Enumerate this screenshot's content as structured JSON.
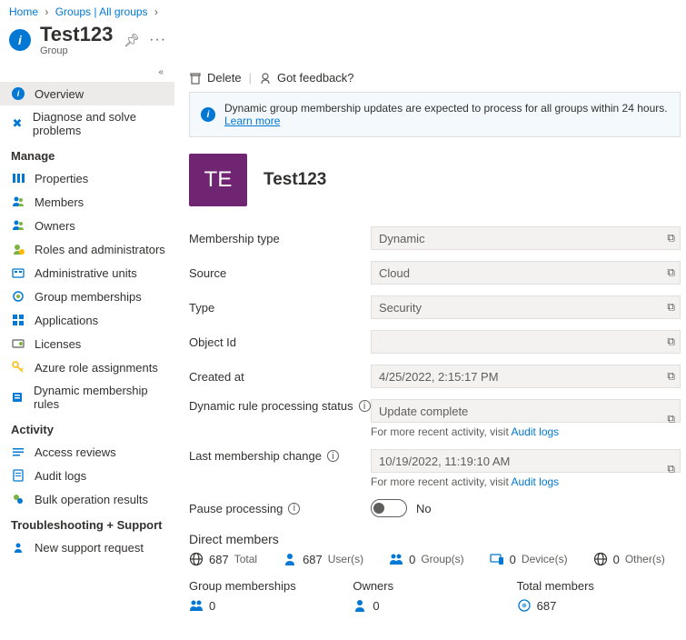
{
  "breadcrumb": {
    "home": "Home",
    "groups": "Groups | All groups"
  },
  "header": {
    "title": "Test123",
    "subtitle": "Group"
  },
  "sidebar": {
    "overview": "Overview",
    "diagnose": "Diagnose and solve problems",
    "heading_manage": "Manage",
    "properties": "Properties",
    "members": "Members",
    "owners": "Owners",
    "roles": "Roles and administrators",
    "admin_units": "Administrative units",
    "group_memberships": "Group memberships",
    "applications": "Applications",
    "licenses": "Licenses",
    "azure_roles": "Azure role assignments",
    "dyn_rules": "Dynamic membership rules",
    "heading_activity": "Activity",
    "access_reviews": "Access reviews",
    "audit_logs": "Audit logs",
    "bulk_results": "Bulk operation results",
    "heading_ts": "Troubleshooting + Support",
    "support_req": "New support request"
  },
  "toolbar": {
    "delete": "Delete",
    "feedback": "Got feedback?"
  },
  "banner": {
    "text": "Dynamic group membership updates are expected to process for all groups within 24 hours.",
    "link": "Learn more"
  },
  "tile": {
    "initials": "TE",
    "title": "Test123"
  },
  "props": {
    "membership_type_label": "Membership type",
    "membership_type_value": "Dynamic",
    "source_label": "Source",
    "source_value": "Cloud",
    "type_label": "Type",
    "type_value": "Security",
    "object_id_label": "Object Id",
    "object_id_value": "",
    "created_label": "Created at",
    "created_value": "4/25/2022, 2:15:17 PM",
    "dyn_status_label": "Dynamic rule processing status",
    "dyn_status_value": "Update complete",
    "hint_prefix": "For more recent activity, visit ",
    "hint_link": "Audit logs",
    "last_change_label": "Last membership change",
    "last_change_value": "10/19/2022, 11:19:10 AM",
    "pause_label": "Pause processing",
    "pause_value": "No"
  },
  "members": {
    "section_title": "Direct members",
    "total_n": "687",
    "total_lbl": "Total",
    "users_n": "687",
    "users_lbl": "User(s)",
    "groups_n": "0",
    "groups_lbl": "Group(s)",
    "devices_n": "0",
    "devices_lbl": "Device(s)",
    "others_n": "0",
    "others_lbl": "Other(s)"
  },
  "bottom": {
    "gm_title": "Group memberships",
    "gm_count": "0",
    "owners_title": "Owners",
    "owners_count": "0",
    "total_title": "Total members",
    "total_count": "687"
  }
}
